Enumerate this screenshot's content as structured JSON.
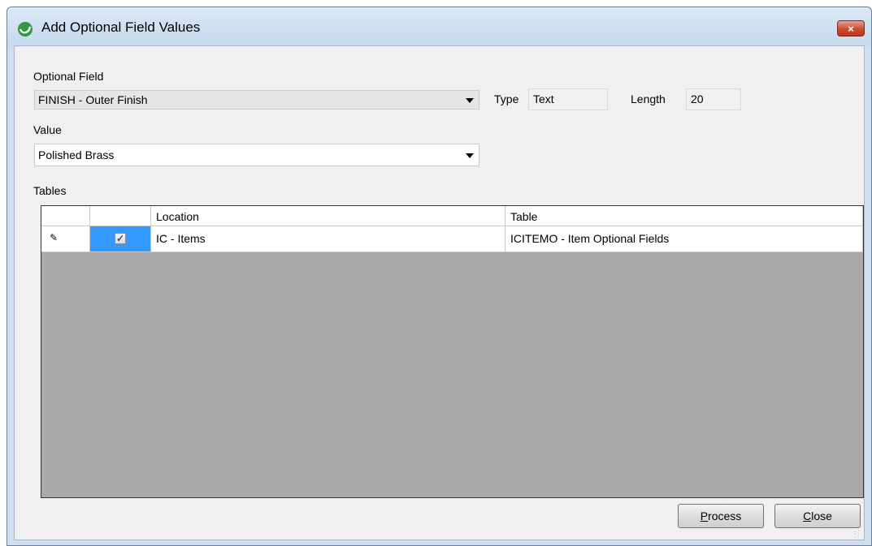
{
  "window": {
    "title": "Add Optional Field Values",
    "close_label": "×"
  },
  "form": {
    "optional_field_label": "Optional Field",
    "optional_field_value": "FINISH - Outer Finish",
    "type_label": "Type",
    "type_value": "Text",
    "length_label": "Length",
    "length_value": "20",
    "value_label": "Value",
    "value_value": "Polished Brass",
    "tables_label": "Tables"
  },
  "grid": {
    "columns": [
      "",
      "Location",
      "Table"
    ],
    "rows": [
      {
        "edit_marker": "✎",
        "checked": true,
        "check_glyph": "✓",
        "location": "IC - Items",
        "table": "ICITEMO - Item Optional Fields"
      }
    ]
  },
  "buttons": {
    "process_mnemonic": "P",
    "process_rest": "rocess",
    "close_mnemonic": "C",
    "close_rest": "lose"
  },
  "colors": {
    "selection": "#3399ff",
    "client_bg": "#f0f0f0",
    "frame": "#cfdff0"
  }
}
